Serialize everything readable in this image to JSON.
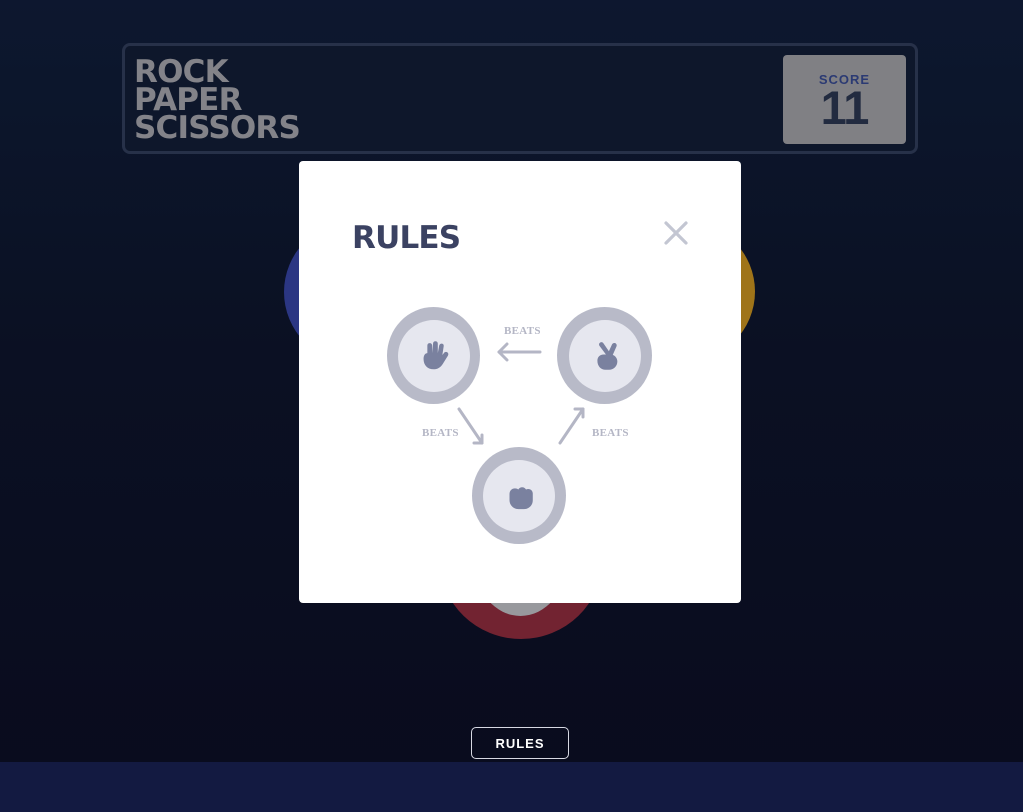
{
  "header": {
    "title_lines": [
      "ROCK",
      "PAPER",
      "SCISSORS"
    ],
    "score_label": "SCORE",
    "score_value": "11"
  },
  "modal": {
    "title": "RULES",
    "beats_labels": {
      "top": "BEATS",
      "left": "BEATS",
      "right": "BEATS"
    }
  },
  "footer": {
    "rules_button_label": "RULES"
  },
  "colors": {
    "background": "#0c1226",
    "header_border": "#2b3650",
    "score_card": "#8b8b90",
    "modal_title": "#3b4262",
    "modal_background": "#ffffff",
    "icons_ring": "#b8bac8",
    "icons_inner": "#e6e7ef",
    "blue_token": "#2f3b8f",
    "yellow_token": "#ad7e1c",
    "red_token": "#7c2636",
    "footer_band": "#131a41"
  },
  "icons": {
    "close": "close-icon",
    "paper": "paper-hand-icon",
    "scissors": "scissors-hand-icon",
    "rock": "rock-hand-icon"
  }
}
